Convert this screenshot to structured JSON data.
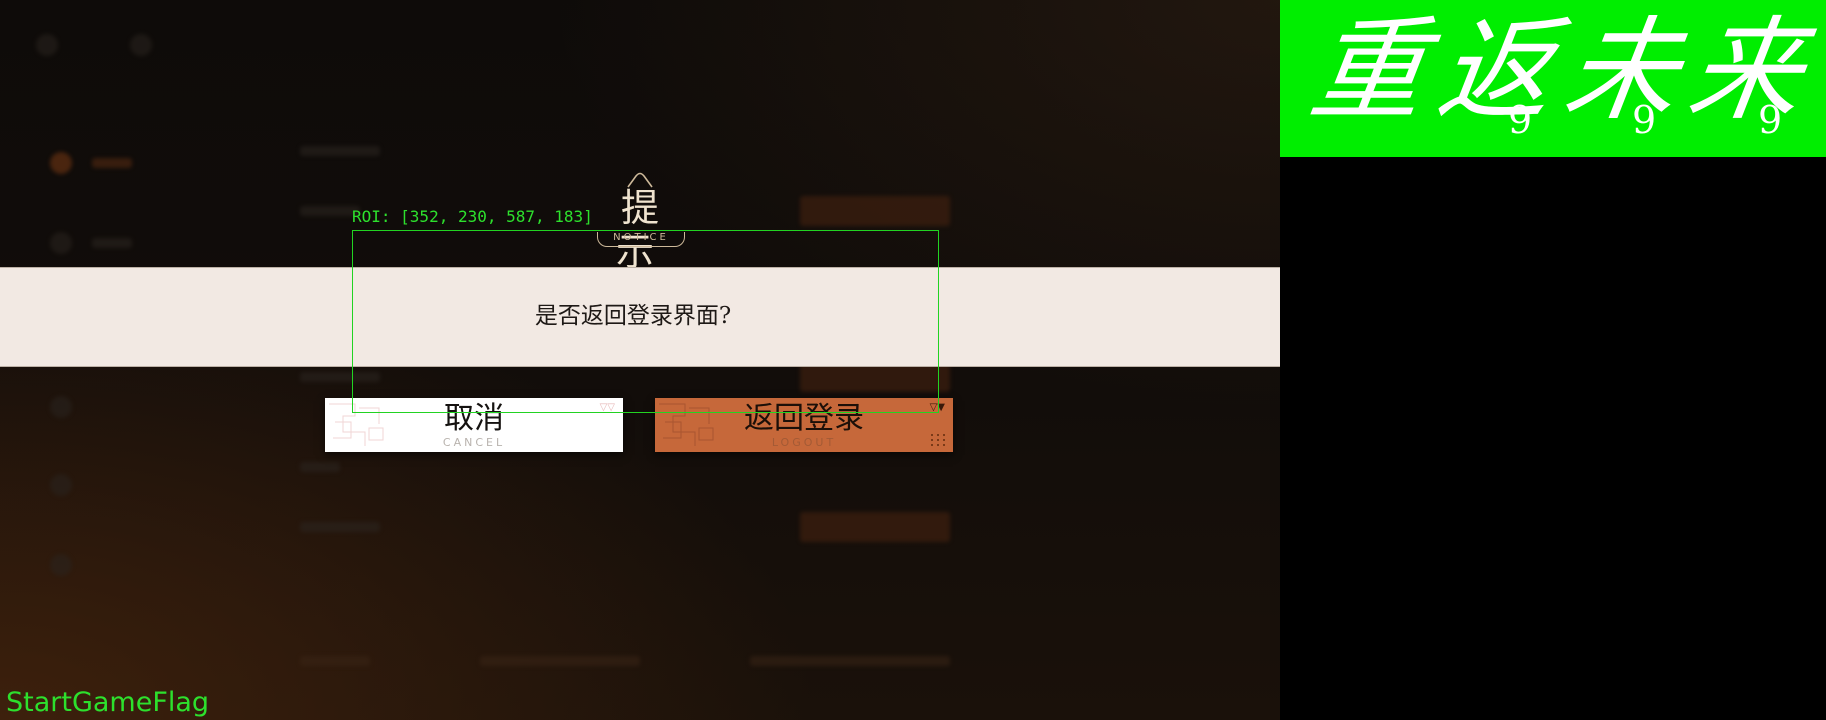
{
  "dialog": {
    "title": "提 示",
    "title_sub": "NOTICE",
    "message": "是否返回登录界面?",
    "cancel": {
      "label": "取消",
      "sub": "CANCEL"
    },
    "confirm": {
      "label": "返回登录",
      "sub": "LOGOUT"
    }
  },
  "overlay": {
    "roi_text": "ROI: [352, 230, 587, 183]",
    "flag_text": "StartGameFlag"
  },
  "logo": {
    "glyphs": [
      "重",
      "返",
      "未",
      "来"
    ],
    "mark": "9"
  },
  "colors": {
    "accent": "#c6683a",
    "band": "#f2e9e3",
    "overlay_green": "#2de02d",
    "logo_bg": "#00ee00"
  },
  "icons": [
    "notice-arch-icon",
    "triangle-marker-icon",
    "dot-grid-icon"
  ]
}
